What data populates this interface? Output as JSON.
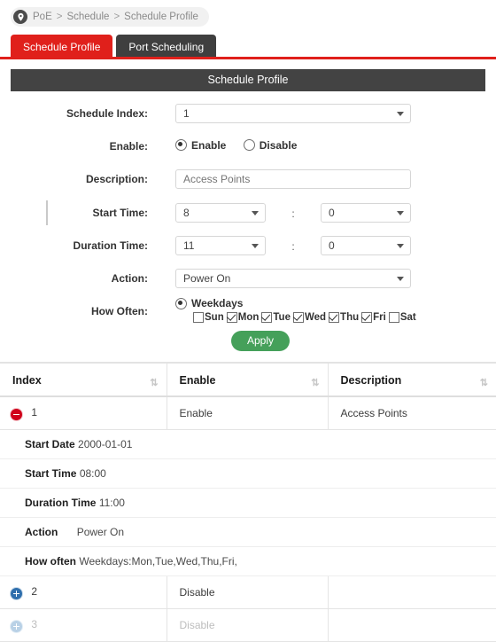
{
  "breadcrumb": {
    "icon": "location-pin-icon",
    "items": [
      "PoE",
      "Schedule",
      "Schedule Profile"
    ],
    "separator": ">"
  },
  "tabs": [
    {
      "label": "Schedule Profile",
      "active": true
    },
    {
      "label": "Port Scheduling",
      "active": false
    }
  ],
  "panel": {
    "title": "Schedule Profile"
  },
  "form": {
    "schedule_index": {
      "label": "Schedule Index:",
      "value": "1"
    },
    "enable": {
      "label": "Enable:",
      "options": [
        "Enable",
        "Disable"
      ],
      "selected": "Enable"
    },
    "description": {
      "label": "Description:",
      "value": "",
      "placeholder": "Access Points"
    },
    "start_time": {
      "label": "Start Time:",
      "hour": "8",
      "minute": "0",
      "separator": ":"
    },
    "duration_time": {
      "label": "Duration Time:",
      "hour": "11",
      "minute": "0",
      "separator": ":"
    },
    "action": {
      "label": "Action:",
      "value": "Power On"
    },
    "how_often": {
      "label": "How Often:",
      "mode": "Weekdays",
      "mode_selected": true,
      "days": [
        {
          "label": "Sun",
          "checked": false
        },
        {
          "label": "Mon",
          "checked": true
        },
        {
          "label": "Tue",
          "checked": true
        },
        {
          "label": "Wed",
          "checked": true
        },
        {
          "label": "Thu",
          "checked": true
        },
        {
          "label": "Fri",
          "checked": true
        },
        {
          "label": "Sat",
          "checked": false
        }
      ]
    },
    "apply_label": "Apply"
  },
  "table": {
    "headers": [
      "Index",
      "Enable",
      "Description"
    ],
    "sort_icon": "sort-updown-icon",
    "rows": [
      {
        "index": "1",
        "enable": "Enable",
        "description": "Access Points",
        "expanded": true,
        "toggle_icon": "collapse-minus-icon",
        "details": [
          {
            "key": "Start Date",
            "value": "2000-01-01"
          },
          {
            "key": "Start Time",
            "value": "08:00"
          },
          {
            "key": "Duration Time",
            "value": "11:00"
          },
          {
            "key": "Action",
            "value": "Power On"
          },
          {
            "key": "How often",
            "value": "Weekdays:Mon,Tue,Wed,Thu,Fri,"
          }
        ]
      },
      {
        "index": "2",
        "enable": "Disable",
        "description": "",
        "expanded": false,
        "toggle_icon": "expand-plus-icon",
        "details": []
      },
      {
        "index": "3",
        "enable": "Disable",
        "description": "",
        "expanded": false,
        "dim": true,
        "toggle_icon": "expand-plus-icon",
        "details": []
      }
    ]
  },
  "colors": {
    "accent_red": "#e0201b",
    "tab_inactive": "#3f3f3f",
    "panel_head": "#434343",
    "apply_green": "#45a05a",
    "minus_red": "#d0021b",
    "plus_blue": "#2f6fad"
  }
}
